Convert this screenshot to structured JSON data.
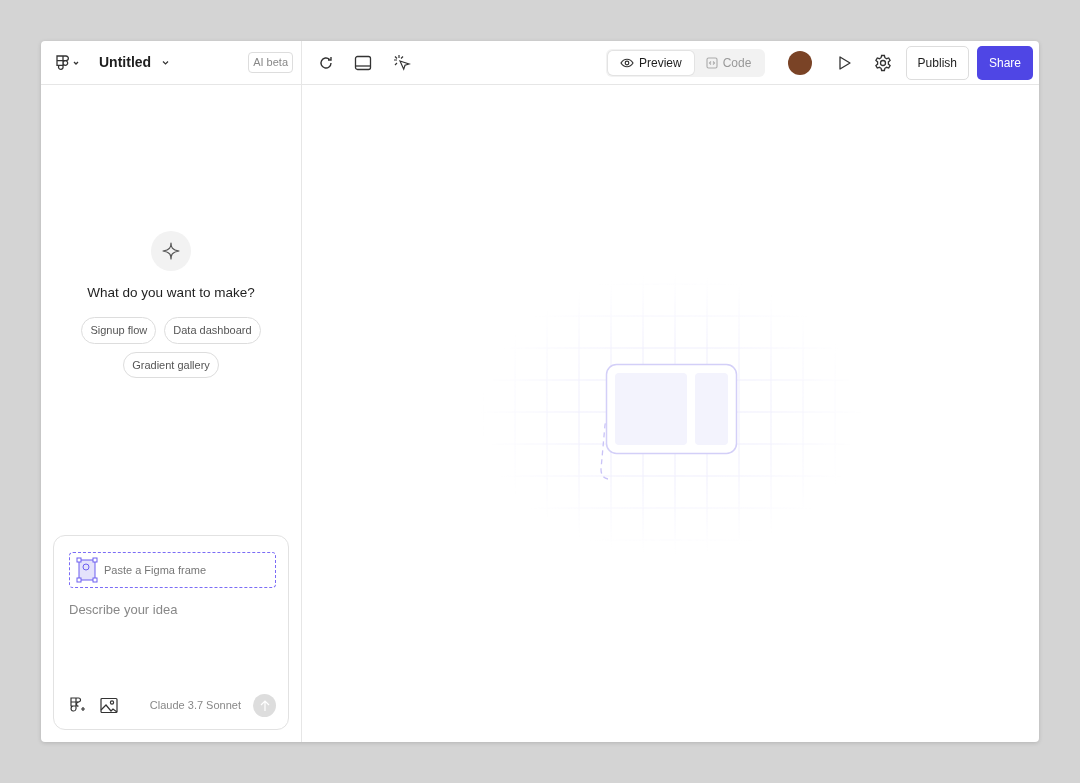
{
  "header": {
    "title": "Untitled",
    "badge": "AI beta"
  },
  "view_toggle": [
    {
      "label": "Preview",
      "selected": true
    },
    {
      "label": "Code",
      "selected": false
    }
  ],
  "actions": {
    "publish": "Publish",
    "share": "Share"
  },
  "prompt_panel": {
    "heading": "What do you want to make?",
    "suggestions": [
      "Signup flow",
      "Data dashboard",
      "Gradient gallery"
    ]
  },
  "composer": {
    "frame_drop": "Paste a Figma frame",
    "placeholder": "Describe your idea",
    "model": "Claude 3.7 Sonnet"
  }
}
